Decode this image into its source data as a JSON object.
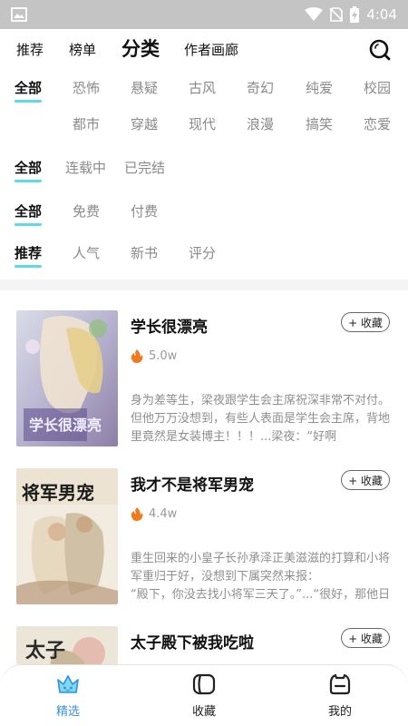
{
  "status_bar": {
    "time": "4:04"
  },
  "top_nav": {
    "tabs": [
      "推荐",
      "榜单",
      "分类",
      "作者画廊"
    ],
    "active": "分类"
  },
  "filters": {
    "genre": [
      "全部",
      "恐怖",
      "悬疑",
      "古风",
      "奇幻",
      "纯爱",
      "校园",
      "都市",
      "穿越",
      "现代",
      "浪漫",
      "搞笑",
      "恋爱"
    ],
    "status": [
      "全部",
      "连载中",
      "已完结"
    ],
    "price": [
      "全部",
      "免费",
      "付费"
    ],
    "sort": [
      "推荐",
      "人气",
      "新书",
      "评分"
    ]
  },
  "books": [
    {
      "title": "学长很漂亮",
      "cover_text": "学长很漂亮",
      "hot": "5.0w",
      "desc": "身为差等生，梁夜跟学生会主席祝深非常不对付。但他万万没想到，有些人表面是学生会主席，背地里竟然是女装博主！！！...梁夜：“好啊",
      "fav_label": "+ 收藏"
    },
    {
      "title": "我才不是将军男宠",
      "cover_text": "将军男宠",
      "hot": "4.4w",
      "desc": "重生回来的小皇子长孙承泽正美滋滋的打算和小将军重归于好，没想到下属突然来报：\n“殿下，你没去找小将军三天了。”...“很好，那他日",
      "fav_label": "+ 收藏"
    },
    {
      "title": "太子殿下被我吃啦",
      "cover_text": "太子",
      "hot": "",
      "desc": "",
      "fav_label": "+ 收藏"
    }
  ],
  "bottom_nav": [
    {
      "label": "精选",
      "icon": "crown-icon",
      "active": true
    },
    {
      "label": "收藏",
      "icon": "bookshelf-icon",
      "active": false
    },
    {
      "label": "我的",
      "icon": "profile-icon",
      "active": false
    }
  ],
  "colors": {
    "accent": "#5ed9e6",
    "active_nav": "#3d8fe0",
    "hot": "#f07a1e"
  }
}
